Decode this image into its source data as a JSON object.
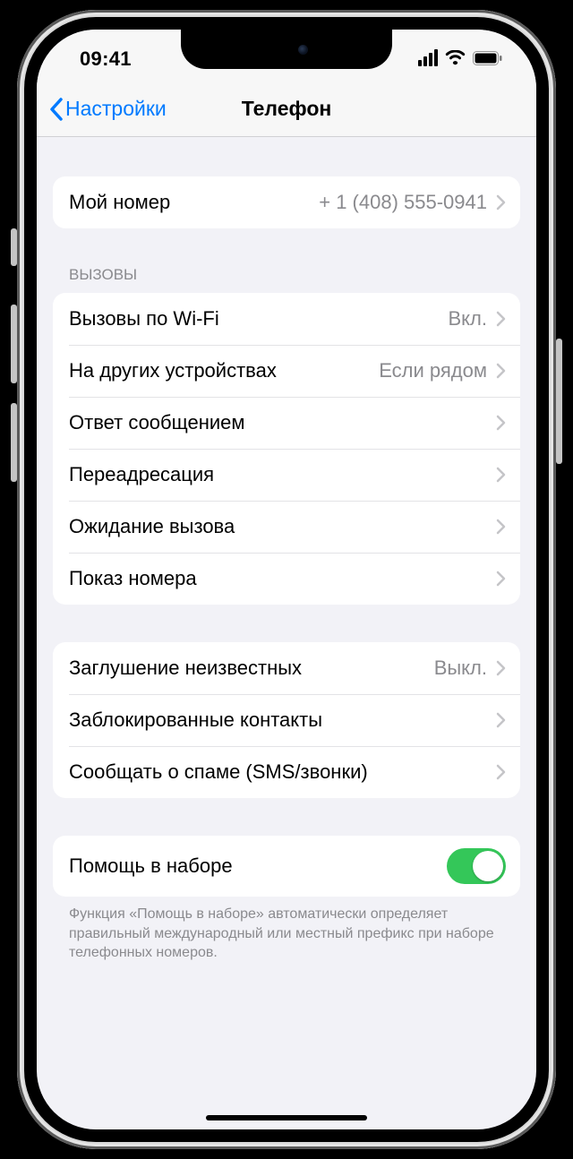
{
  "status": {
    "time": "09:41"
  },
  "nav": {
    "back_label": "Настройки",
    "title": "Телефон"
  },
  "groups": {
    "my_number": {
      "label": "Мой номер",
      "value": "+ 1 (408) 555-0941"
    },
    "calls_header": "ВЫЗОВЫ",
    "calls": [
      {
        "label": "Вызовы по Wi-Fi",
        "value": "Вкл."
      },
      {
        "label": "На других устройствах",
        "value": "Если рядом"
      },
      {
        "label": "Ответ сообщением",
        "value": ""
      },
      {
        "label": "Переадресация",
        "value": ""
      },
      {
        "label": "Ожидание вызова",
        "value": ""
      },
      {
        "label": "Показ номера",
        "value": ""
      }
    ],
    "block": [
      {
        "label": "Заглушение неизвестных",
        "value": "Выкл."
      },
      {
        "label": "Заблокированные контакты",
        "value": ""
      },
      {
        "label": "Сообщать о спаме (SMS/звонки)",
        "value": ""
      }
    ],
    "assist": {
      "label": "Помощь в наборе",
      "on": true
    },
    "footer": "Функция «Помощь в наборе» автоматически определяет правильный международный или местный префикс при наборе телефонных номеров."
  }
}
